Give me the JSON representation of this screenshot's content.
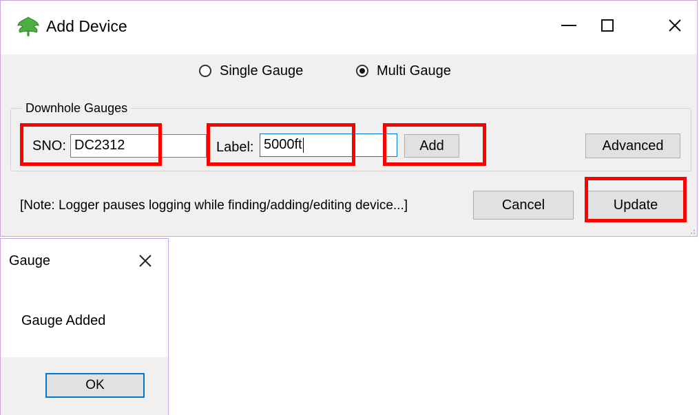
{
  "main_window": {
    "title": "Add Device",
    "title_icon": "leaf-icon",
    "controls": {
      "minimize": "minimize-icon",
      "maximize": "maximize-icon",
      "close": "close-icon"
    },
    "mode_options": [
      {
        "label": "Single Gauge",
        "selected": false
      },
      {
        "label": "Multi Gauge",
        "selected": true
      }
    ],
    "group": {
      "legend": "Downhole Gauges",
      "sno_label": "SNO:",
      "sno_value": "DC2312",
      "label_label": "Label:",
      "label_value": "5000ft",
      "add_button": "Add",
      "advanced_button": "Advanced"
    },
    "note": "[Note: Logger pauses logging while finding/adding/editing device...]",
    "cancel_button": "Cancel",
    "update_button": "Update",
    "annotation_color": "#ff0000"
  },
  "dialog": {
    "title": "Gauge",
    "message": "Gauge Added",
    "ok_button": "OK",
    "close_icon": "close-icon"
  }
}
